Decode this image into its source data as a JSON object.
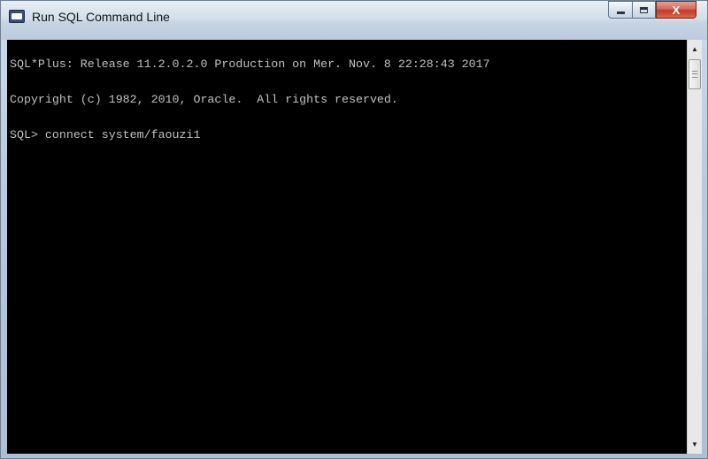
{
  "window": {
    "title": "Run SQL Command Line"
  },
  "caption_buttons": {
    "minimize_icon": "minimize-icon",
    "maximize_icon": "maximize-icon",
    "close_label": "X"
  },
  "console": {
    "background": "#000000",
    "text_color": "#c0c0c0",
    "lines": [
      "SQL*Plus: Release 11.2.0.2.0 Production on Mer. Nov. 8 22:28:43 2017",
      "Copyright (c) 1982, 2010, Oracle.  All rights reserved.",
      "SQL> connect system/faouzi1"
    ]
  },
  "scrollbar": {
    "up_icon": "scroll-up-arrow-icon",
    "down_icon": "scroll-down-arrow-icon"
  }
}
